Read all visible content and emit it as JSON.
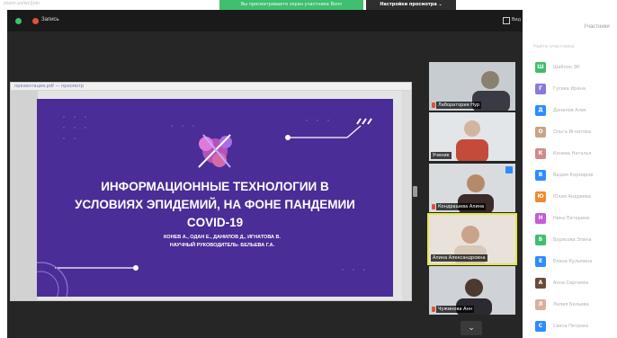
{
  "browser": {
    "url_text": "zoom.us/wc/join",
    "share_banner": "Вы просматриваете экран участника Bonn",
    "view_options": "Настройки просмотра ⌄"
  },
  "zoom": {
    "record_label": "Запись",
    "view_label": "Вид"
  },
  "share_window": {
    "title": "презентация.pdf — просмотр"
  },
  "slide": {
    "title_lines": [
      "Информационные технологии в",
      "условиях эпидемий, на фоне пандемии",
      "COVID-19"
    ],
    "author_lines": [
      "КОНЕВ А., ОДАН Е., ДАНИЛОВ Д., ИГНАТОВА В.",
      "НАУЧНЫЙ РУКОВОДИТЕЛЬ- БЕЛЬЕВА Г.А."
    ],
    "colors": {
      "background": "#4a2d96",
      "accent": "#c9a7ff"
    }
  },
  "gallery": {
    "scroll_glyph": "⌄",
    "tiles": [
      {
        "name": "Лаборатория Нур",
        "mic_muted": true,
        "active": false,
        "tone": "#8a8070"
      },
      {
        "name": "Ученик",
        "mic_muted": false,
        "active": false,
        "tone": "#d2b59e"
      },
      {
        "name": "Кондрашева Алина",
        "mic_muted": true,
        "active": false,
        "tone": "#b58a6a"
      },
      {
        "name": "Алина Александровна",
        "mic_muted": false,
        "active": true,
        "tone": "#c9a48a"
      },
      {
        "name": "Чужинова Анн",
        "mic_muted": true,
        "active": false,
        "tone": "#4a3a30"
      }
    ]
  },
  "participants": {
    "title": "Участники",
    "search_placeholder": "Найти участника",
    "items": [
      {
        "letter": "Ш",
        "name": "Шаблон ЭК",
        "color": "#3fbf6f"
      },
      {
        "letter": "Г",
        "name": "Гусева Ирина",
        "color": "#8a7ad8"
      },
      {
        "letter": "Д",
        "name": "Данилов Алек",
        "color": "#2d8cff"
      },
      {
        "letter": "О",
        "name": "Ольга Игнатова",
        "color": "#c9a48a"
      },
      {
        "letter": "К",
        "name": "Конева Наталья",
        "color": "#d28a8a"
      },
      {
        "letter": "В",
        "name": "Вадим Кормаров",
        "color": "#2d8cff"
      },
      {
        "letter": "Ю",
        "name": "Юлия Андреева",
        "color": "#f08a2d"
      },
      {
        "letter": "Н",
        "name": "Ника Пятерина",
        "color": "#c65bd8"
      },
      {
        "letter": "Б",
        "name": "Борисова Элина",
        "color": "#3fbf6f"
      },
      {
        "letter": "Е",
        "name": "Елена Кульмина",
        "color": "#2d8cff"
      },
      {
        "letter": "А",
        "name": "Анна Сергеева",
        "color": "#6a4a3a"
      },
      {
        "letter": "Л",
        "name": "Лилия Бельева",
        "color": "#d8b0a0"
      },
      {
        "letter": "С",
        "name": "Света Петрова",
        "color": "#2d8cff"
      }
    ]
  }
}
